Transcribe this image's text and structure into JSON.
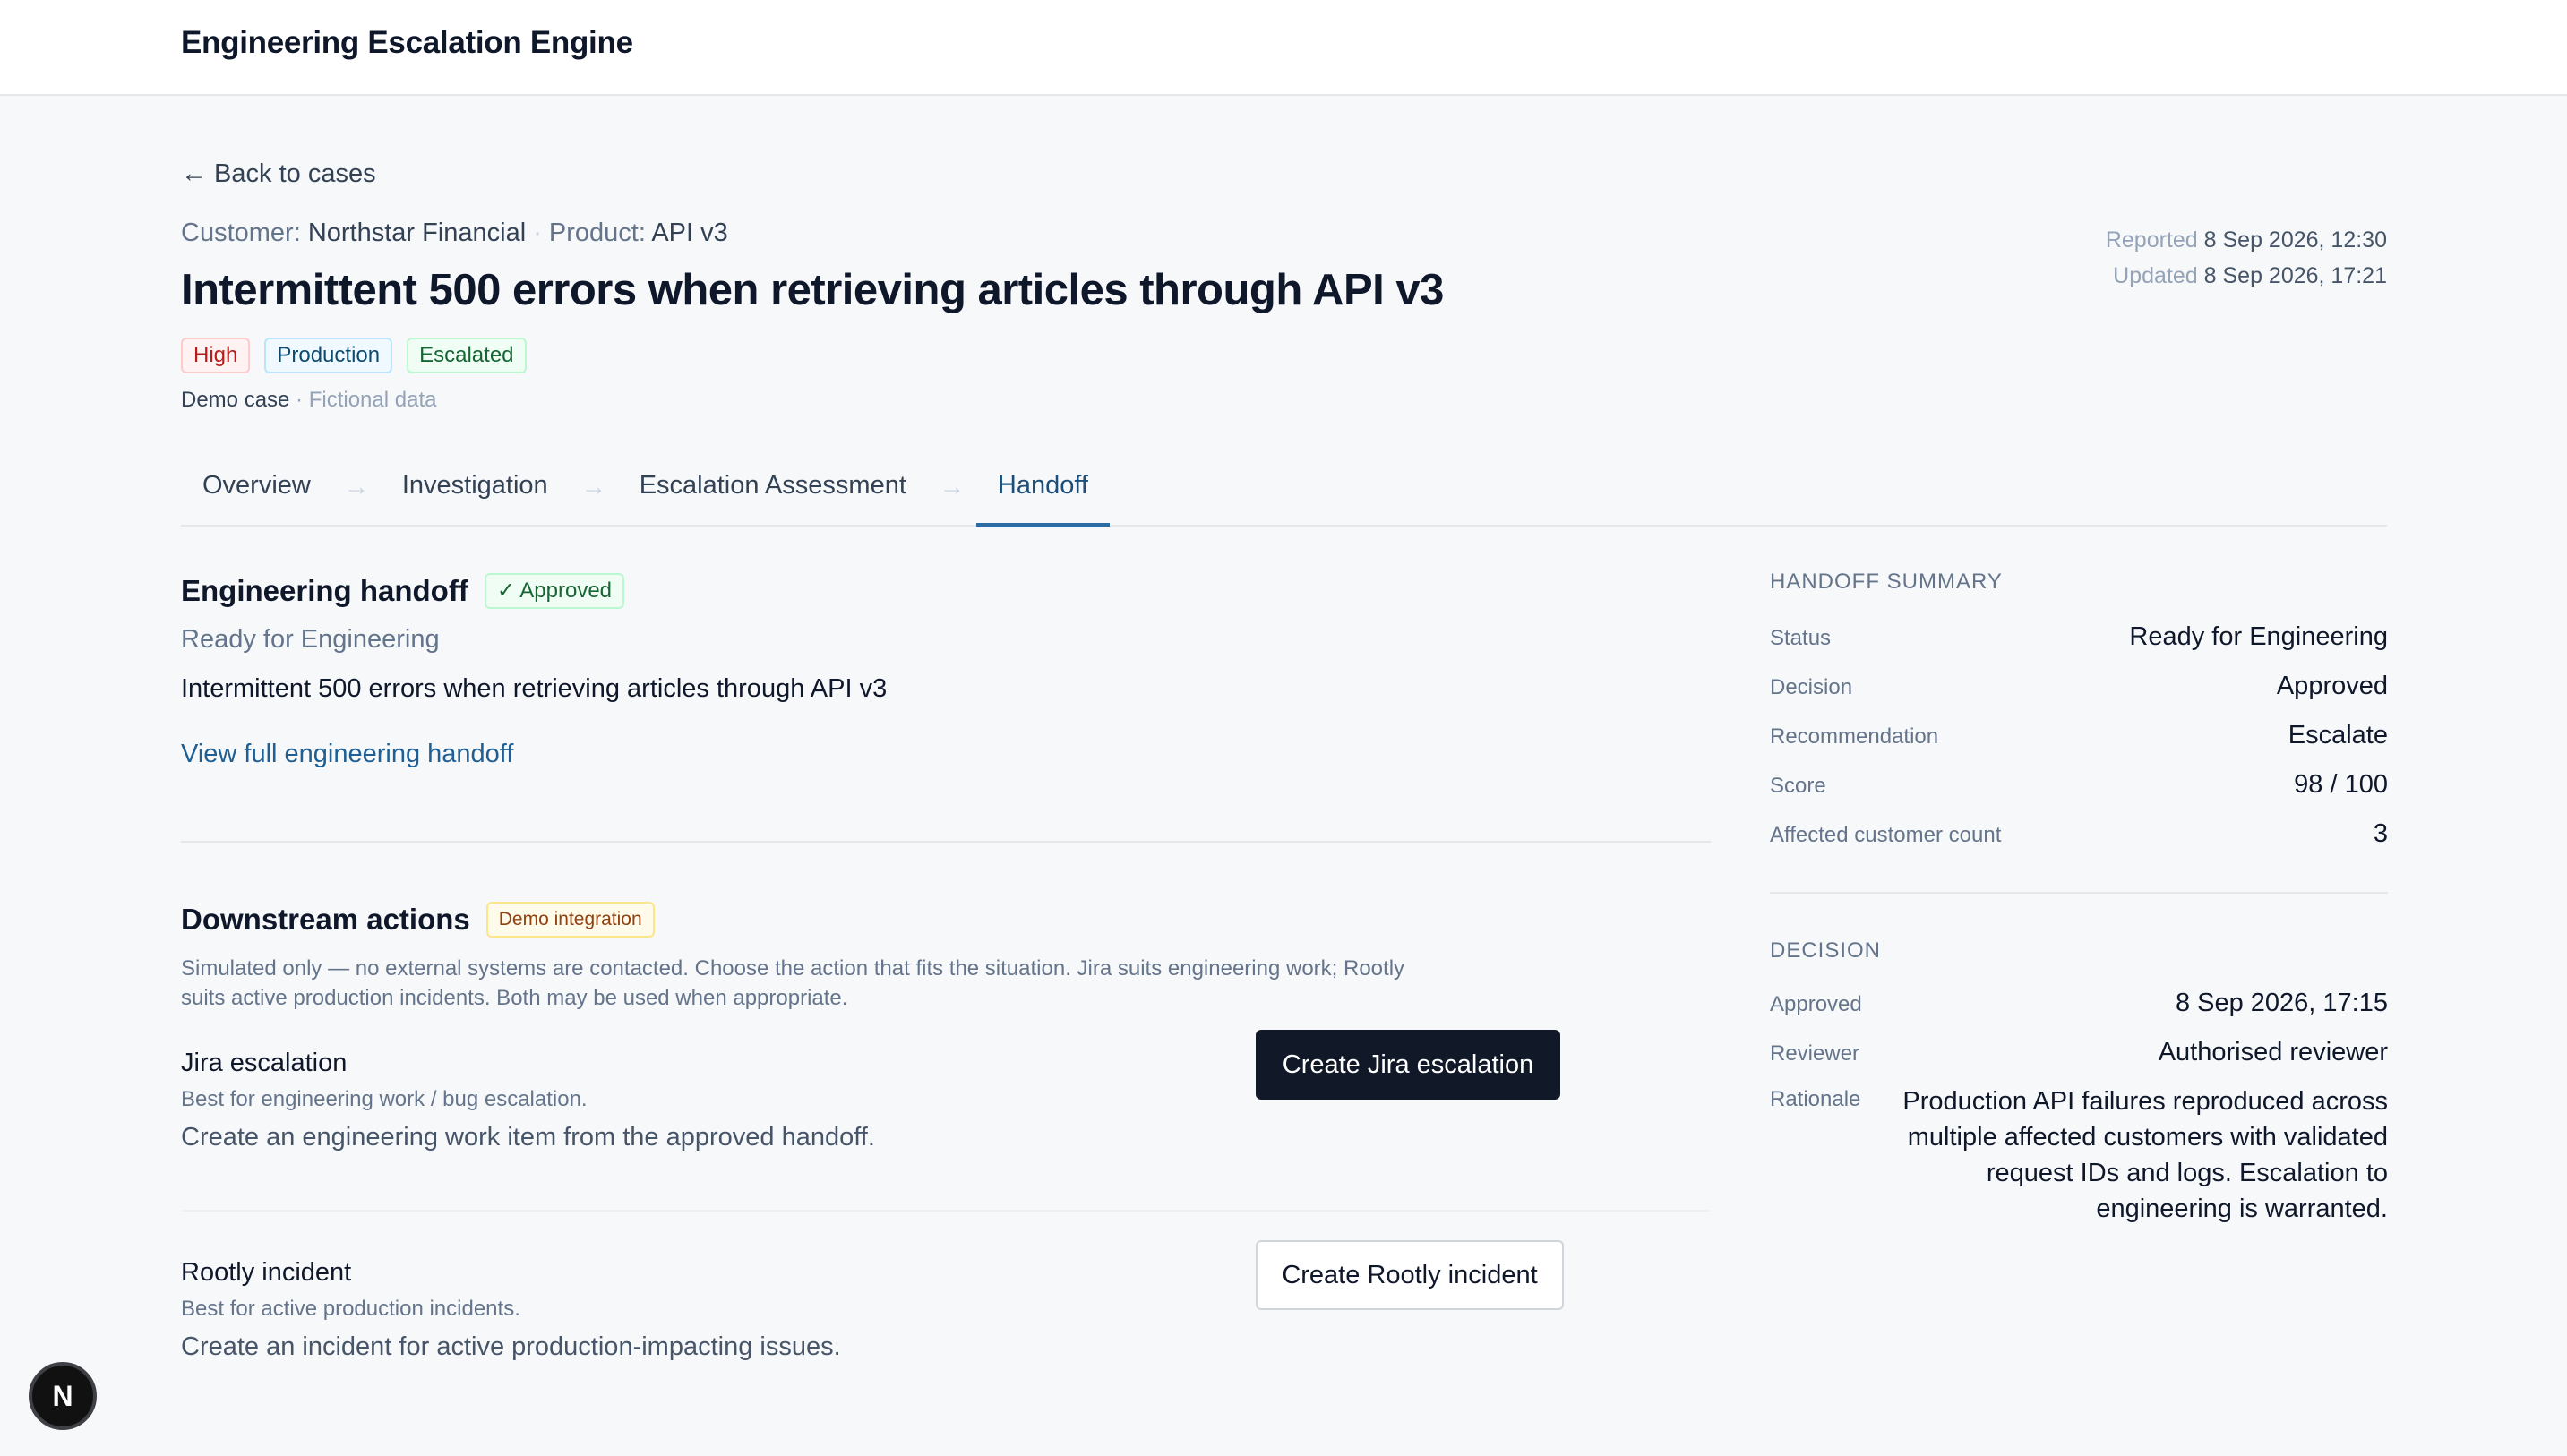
{
  "app": {
    "title": "Engineering Escalation Engine"
  },
  "nav": {
    "back_label": "← Back to cases"
  },
  "case": {
    "customer_label": "Customer:",
    "customer": "Northstar Financial",
    "product_label": "Product:",
    "product": "API v3",
    "reported_label": "Reported",
    "reported": "8 Sep 2026, 12:30",
    "updated_label": "Updated",
    "updated": "8 Sep 2026, 17:21",
    "title": "Intermittent 500 errors when retrieving articles through API v3",
    "badges": {
      "severity": "High",
      "environment": "Production",
      "status": "Escalated"
    },
    "demo_strong": "Demo case",
    "demo_rest": " · Fictional data"
  },
  "tabs": [
    {
      "label": "Overview"
    },
    {
      "label": "Investigation"
    },
    {
      "label": "Escalation Assessment"
    },
    {
      "label": "Handoff"
    }
  ],
  "tab_arrow": "→",
  "handoff": {
    "heading": "Engineering handoff",
    "approved_badge": "✓ Approved",
    "status_text": "Ready for Engineering",
    "title": "Intermittent 500 errors when retrieving articles through API v3",
    "view_link": "View full engineering handoff"
  },
  "downstream": {
    "heading": "Downstream actions",
    "badge": "Demo integration",
    "note": "Simulated only — no external systems are contacted. Choose the action that fits the situation. Jira suits engineering work; Rootly suits active production incidents. Both may be used when appropriate.",
    "jira": {
      "title": "Jira escalation",
      "subtitle": "Best for engineering work / bug escalation.",
      "description": "Create an engineering work item from the approved handoff.",
      "button": "Create Jira escalation"
    },
    "rootly": {
      "title": "Rootly incident",
      "subtitle": "Best for active production incidents.",
      "description": "Create an incident for active production-impacting issues.",
      "button": "Create Rootly incident"
    }
  },
  "summary": {
    "heading": "Handoff summary",
    "rows": [
      {
        "key": "Status",
        "value": "Ready for Engineering"
      },
      {
        "key": "Decision",
        "value": "Approved"
      },
      {
        "key": "Recommendation",
        "value": "Escalate"
      },
      {
        "key": "Score",
        "value": "98 / 100"
      },
      {
        "key": "Affected customer count",
        "value": "3"
      }
    ]
  },
  "decision": {
    "heading": "Decision",
    "rows": [
      {
        "key": "Approved",
        "value": "8 Sep 2026, 17:15"
      },
      {
        "key": "Reviewer",
        "value": "Authorised reviewer"
      },
      {
        "key": "Rationale",
        "value": "Production API failures reproduced across multiple affected customers with validated request IDs and logs. Escalation to engineering is warranted."
      }
    ]
  },
  "framework_badge": "N"
}
